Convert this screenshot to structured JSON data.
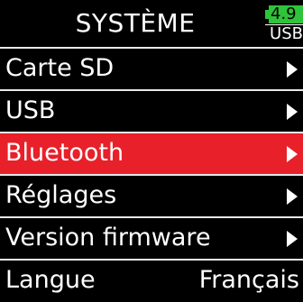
{
  "header": {
    "title": "SYSTÈME",
    "battery": {
      "level_text": "4.9",
      "source": "USB",
      "fill_color": "#2fc33a"
    }
  },
  "menu": {
    "selected_index": 2,
    "selected_color": "#e8202a",
    "items": [
      {
        "label": "Carte SD",
        "icon": "chevron-right-icon"
      },
      {
        "label": "USB",
        "icon": "chevron-right-icon"
      },
      {
        "label": "Bluetooth",
        "icon": "chevron-right-icon"
      },
      {
        "label": "Réglages",
        "icon": "chevron-right-icon"
      },
      {
        "label": "Version firmware",
        "icon": "chevron-right-icon"
      },
      {
        "label": "Langue",
        "value": "Français"
      }
    ]
  }
}
